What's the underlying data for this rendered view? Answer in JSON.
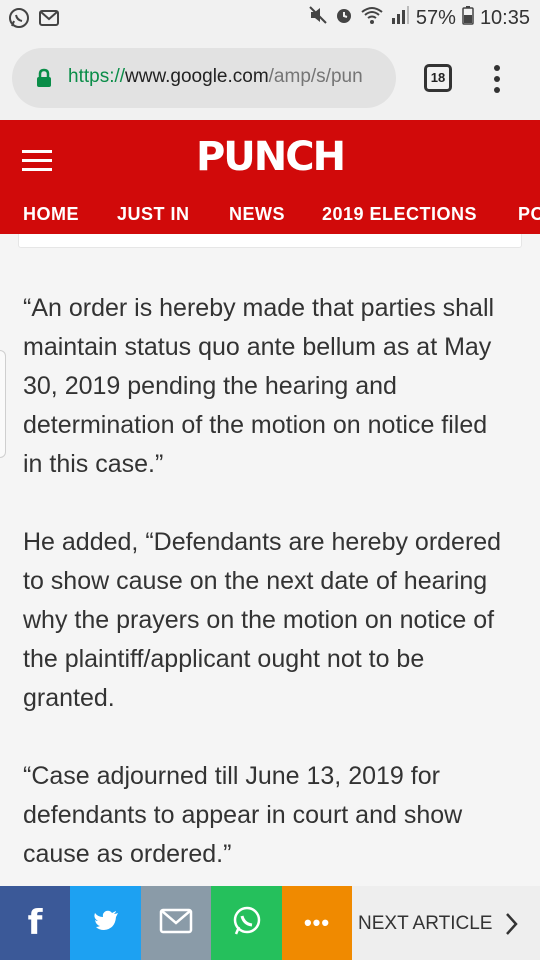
{
  "status_bar": {
    "battery": "57%",
    "time": "10:35",
    "icons": [
      "whatsapp-icon",
      "mail-icon",
      "mute-icon",
      "alarm-icon",
      "wifi-icon",
      "signal-icon",
      "battery-icon"
    ]
  },
  "browser": {
    "url_scheme": "https://",
    "url_host": "www.google.com",
    "url_path": "/amp/s/pun",
    "tab_count": "18"
  },
  "site": {
    "logo": "PUNCH",
    "nav": [
      "HOME",
      "JUST IN",
      "NEWS",
      "2019 ELECTIONS",
      "PO"
    ],
    "brand_color": "#d10a0a"
  },
  "article": {
    "paragraphs": [
      "“An order is hereby made that parties shall maintain status quo ante bellum as at May 30, 2019 pending the hearing and determination of the motion on notice filed in this case.”",
      "He added, “Defendants are hereby ordered to show cause on the next date of hearing why the prayers on the motion on notice of the plaintiff/applicant ought not to be granted.",
      "“Case adjourned till June 13, 2019 for defendants to appear in court and show cause as ordered.”"
    ]
  },
  "share_bar": {
    "buttons": [
      {
        "name": "facebook",
        "color": "#3b5998"
      },
      {
        "name": "twitter",
        "color": "#1da1f2"
      },
      {
        "name": "email",
        "color": "#8a9ba8"
      },
      {
        "name": "whatsapp",
        "color": "#25c05c"
      },
      {
        "name": "more",
        "color": "#f08a00"
      }
    ],
    "facebook_glyph": "f",
    "more_glyph": "•••",
    "next_label": "NEXT ARTICLE"
  }
}
